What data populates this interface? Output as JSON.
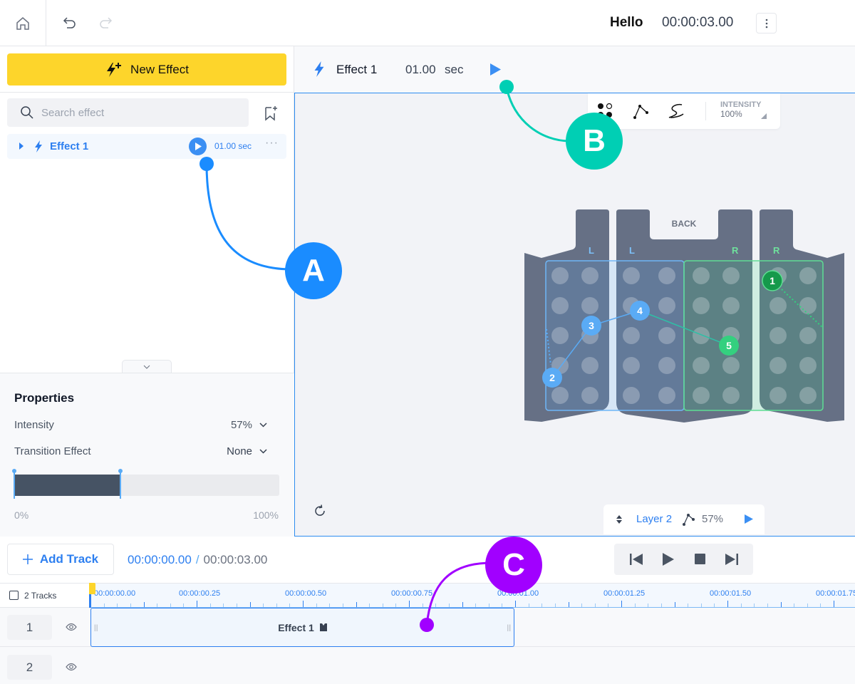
{
  "topbar": {
    "title": "Hello",
    "time": "00:00:03.00",
    "icons": [
      "home-icon",
      "undo-icon",
      "redo-icon",
      "more-vertical-icon"
    ]
  },
  "sidebar": {
    "new_effect_label": "New Effect",
    "search_placeholder": "Search effect",
    "effects": [
      {
        "name": "Effect 1",
        "duration": "01.00 sec"
      }
    ]
  },
  "properties": {
    "title": "Properties",
    "intensity_label": "Intensity",
    "intensity_value": "57%",
    "transition_label": "Transition Effect",
    "transition_value": "None",
    "range_min": "0%",
    "range_max": "100%",
    "range_fill_percent": 40
  },
  "effect_header": {
    "name": "Effect 1",
    "duration": "01.00",
    "unit": "sec"
  },
  "toolbox": {
    "intensity_label": "INTENSITY",
    "intensity_value": "100%"
  },
  "vest": {
    "back_label": "BACK",
    "side_labels": [
      "L",
      "L",
      "R",
      "R"
    ],
    "markers": [
      "1",
      "2",
      "3",
      "4",
      "5"
    ],
    "colors": {
      "left": "#5aabf5",
      "right": "#34d07f",
      "marker1": "#15994b"
    }
  },
  "layer_bar": {
    "layer": "Layer 2",
    "intensity": "57%"
  },
  "timeline": {
    "add_track_label": "Add Track",
    "current_time": "00:00:00.00",
    "separator": "/",
    "total_time": "00:00:03.00",
    "tracks_label": "2 Tracks",
    "ticks": [
      "00:00:00.00",
      "00:00:00.25",
      "00:00:00.50",
      "00:00:00.75",
      "00:00:01.00",
      "00:00:01.25",
      "00:00:01.50",
      "00:00:01.75"
    ],
    "tracks": [
      {
        "number": "1",
        "clip": "Effect 1"
      },
      {
        "number": "2"
      }
    ]
  },
  "annotations": {
    "a": "A",
    "b": "B",
    "c": "C",
    "colors": {
      "a": "#1a8cff",
      "b": "#00cfb4",
      "c": "#a100ff"
    }
  }
}
